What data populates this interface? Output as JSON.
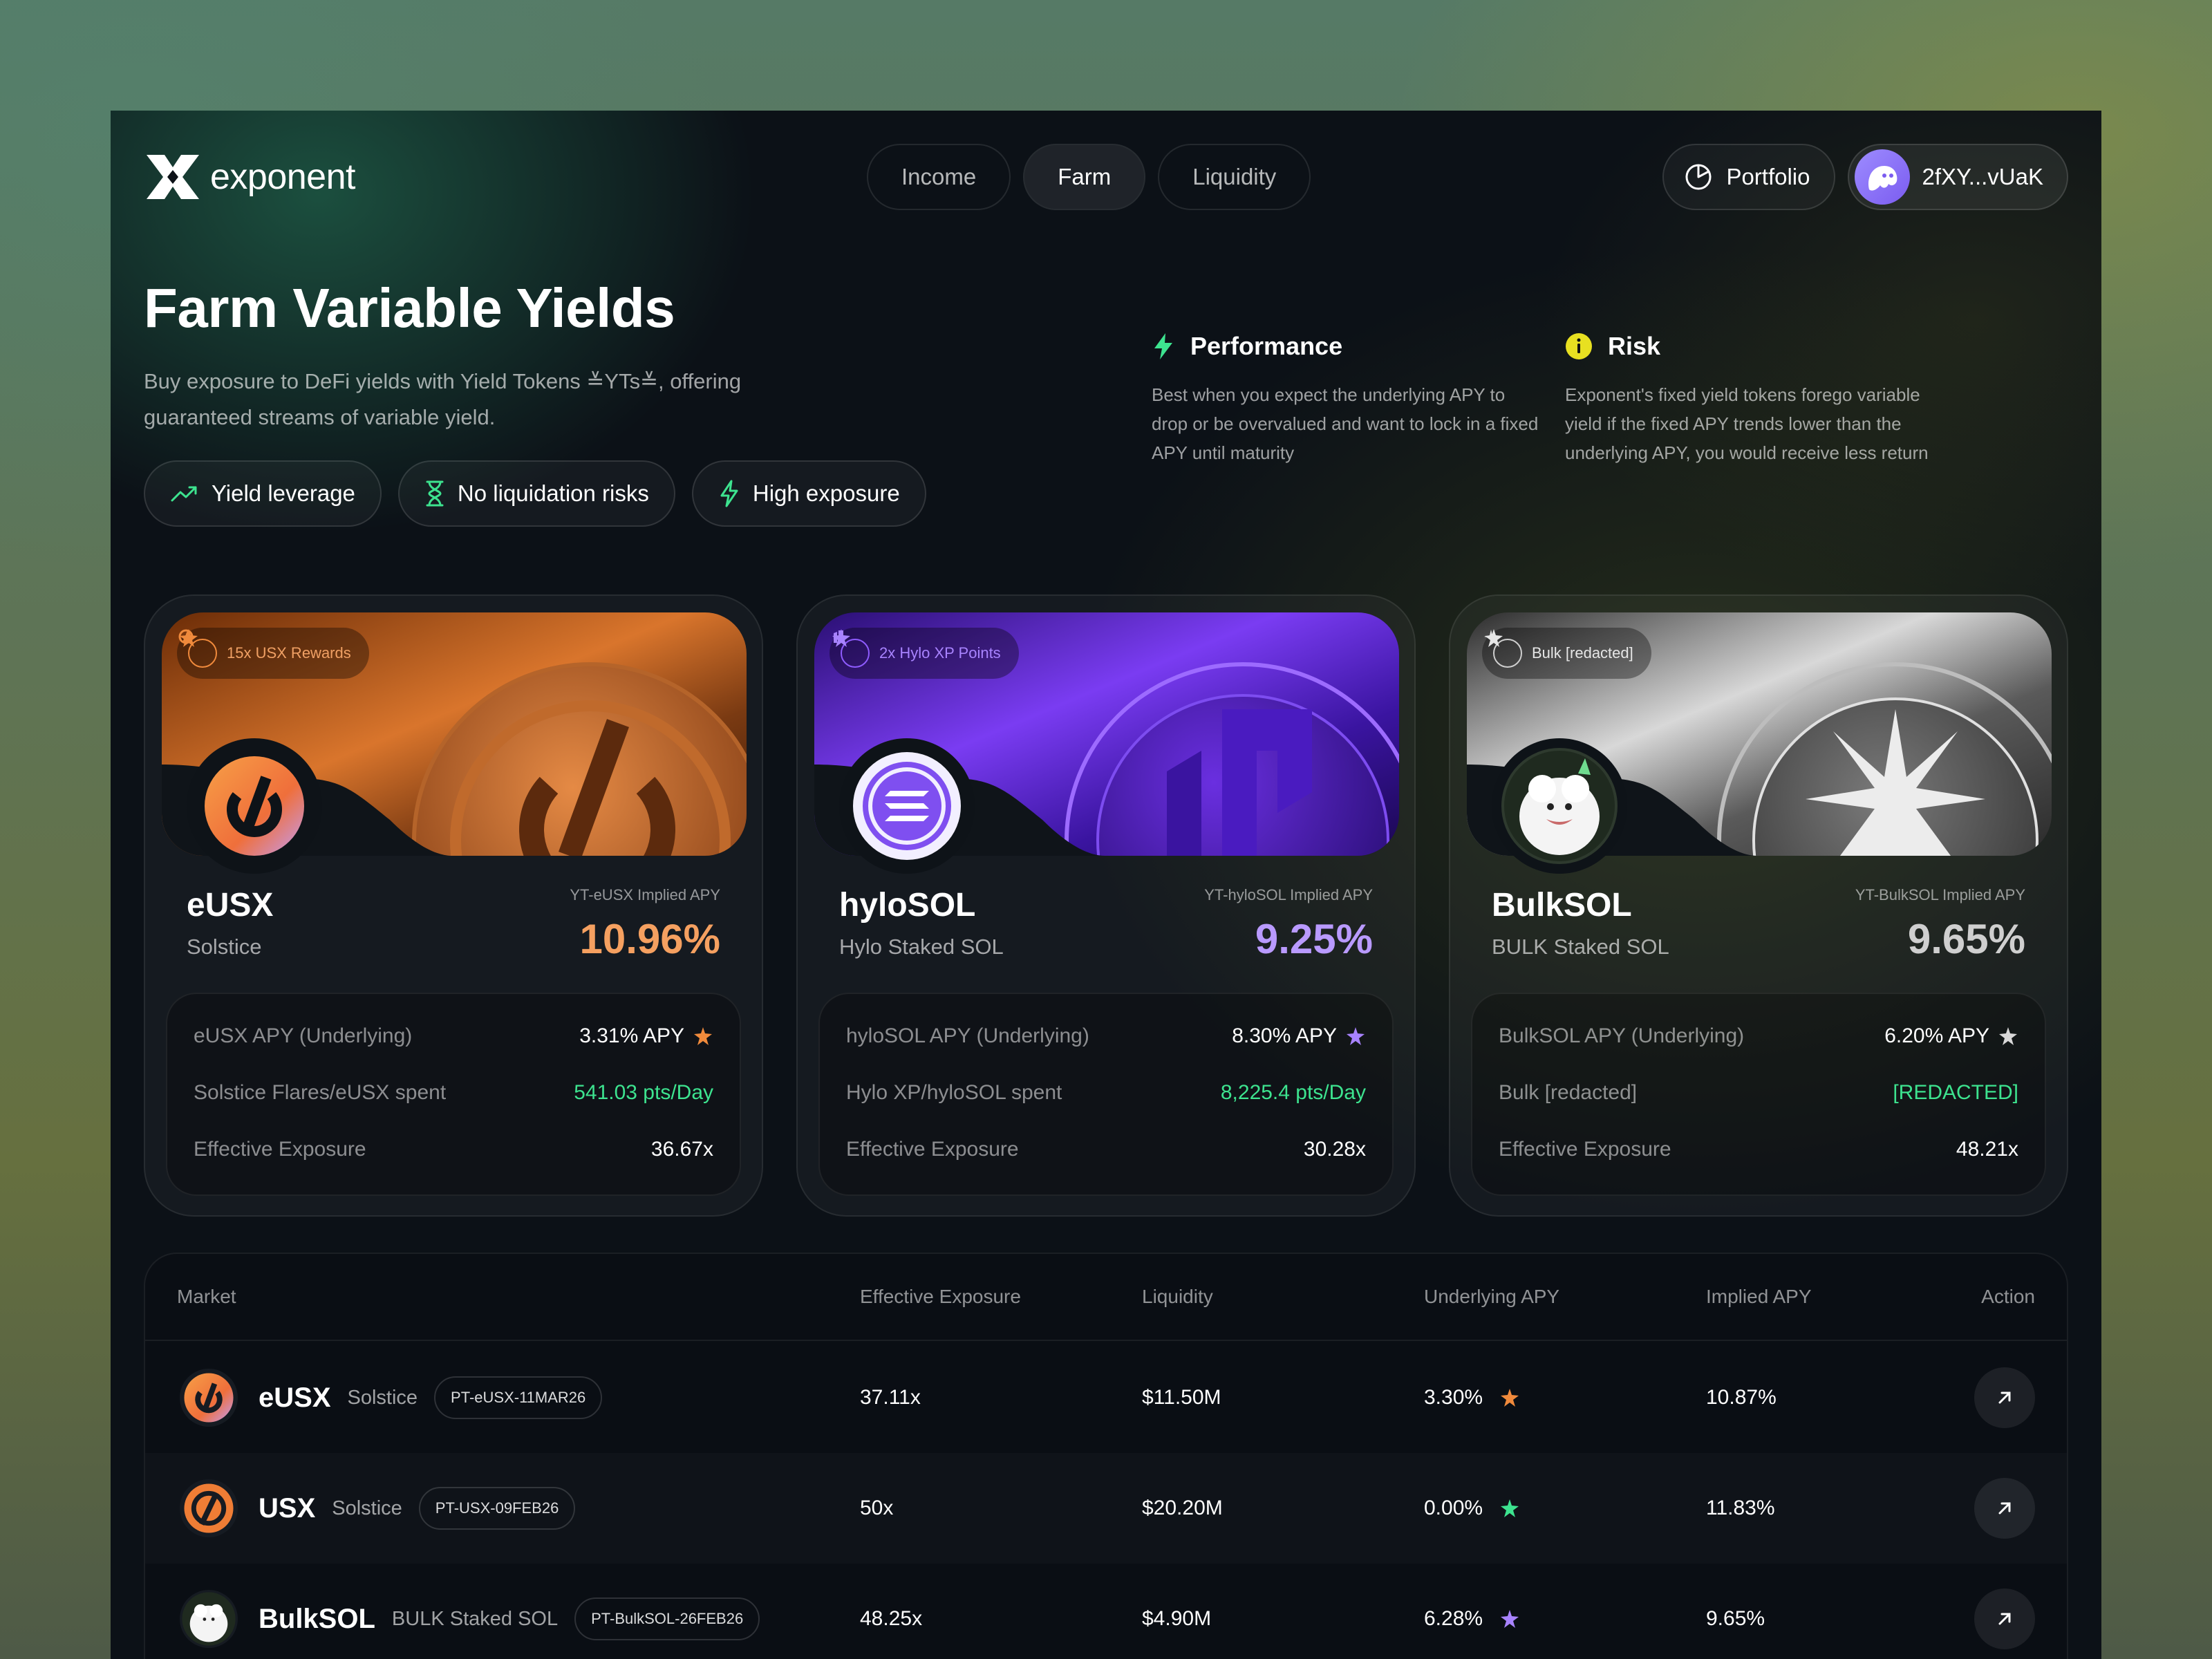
{
  "brand": {
    "name": "exponent"
  },
  "nav": {
    "tabs": [
      {
        "label": "Income"
      },
      {
        "label": "Farm"
      },
      {
        "label": "Liquidity"
      }
    ],
    "active": "Farm"
  },
  "header": {
    "portfolio_label": "Portfolio",
    "wallet_label": "2fXY...vUaK"
  },
  "hero": {
    "title": "Farm Variable Yields",
    "subtitle": "Buy exposure to DeFi yields with Yield Tokens ≚YTs≚, offering guaranteed streams of variable yield.",
    "chips": [
      {
        "label": "Yield leverage",
        "icon": "trend-up-icon"
      },
      {
        "label": "No liquidation risks",
        "icon": "hourglass-icon"
      },
      {
        "label": "High exposure",
        "icon": "lightning-icon"
      }
    ]
  },
  "info": {
    "performance": {
      "title": "Performance",
      "body": "Best when you expect the underlying APY to drop or be overvalued and want to lock in a fixed APY until maturity"
    },
    "risk": {
      "title": "Risk",
      "body": "Exponent's fixed yield tokens forego variable yield if the fixed APY trends lower than the underlying APY, you would receive less return"
    }
  },
  "cards": [
    {
      "badge": "15x USX Rewards",
      "name": "eUSX",
      "protocol": "Solstice",
      "implied_label": "YT-eUSX Implied APY",
      "implied_value": "10.96%",
      "stats": [
        {
          "label": "eUSX APY (Underlying)",
          "value": "3.31% APY"
        },
        {
          "label": "Solstice Flares/eUSX spent",
          "value": "541.03 pts/Day"
        },
        {
          "label": "Effective Exposure",
          "value": "36.67x"
        }
      ],
      "accent": "#f08a3c"
    },
    {
      "badge": "2x Hylo XP Points",
      "name": "hyloSOL",
      "protocol": "Hylo Staked SOL",
      "implied_label": "YT-hyloSOL Implied APY",
      "implied_value": "9.25%",
      "stats": [
        {
          "label": "hyloSOL APY (Underlying)",
          "value": "8.30% APY"
        },
        {
          "label": "Hylo XP/hyloSOL spent",
          "value": "8,225.4 pts/Day"
        },
        {
          "label": "Effective Exposure",
          "value": "30.28x"
        }
      ],
      "accent": "#8f5cff"
    },
    {
      "badge": "Bulk [redacted]",
      "name": "BulkSOL",
      "protocol": "BULK Staked SOL",
      "implied_label": "YT-BulkSOL Implied APY",
      "implied_value": "9.65%",
      "stats": [
        {
          "label": "BulkSOL APY (Underlying)",
          "value": "6.20% APY"
        },
        {
          "label": "Bulk [redacted]",
          "value": "[REDACTED]"
        },
        {
          "label": "Effective Exposure",
          "value": "48.21x"
        }
      ],
      "accent": "#c9c9c9"
    }
  ],
  "table": {
    "headers": {
      "market": "Market",
      "exposure": "Effective Exposure",
      "liquidity": "Liquidity",
      "underlying": "Underlying APY",
      "implied": "Implied APY",
      "action": "Action"
    },
    "rows": [
      {
        "name": "eUSX",
        "protocol": "Solstice",
        "pt": "PT-eUSX-11MAR26",
        "exposure": "37.11x",
        "liquidity": "$11.50M",
        "underlying": "3.30%",
        "implied": "10.87%"
      },
      {
        "name": "USX",
        "protocol": "Solstice",
        "pt": "PT-USX-09FEB26",
        "exposure": "50x",
        "liquidity": "$20.20M",
        "underlying": "0.00%",
        "implied": "11.83%"
      },
      {
        "name": "BulkSOL",
        "protocol": "BULK Staked SOL",
        "pt": "PT-BulkSOL-26FEB26",
        "exposure": "48.25x",
        "liquidity": "$4.90M",
        "underlying": "6.28%",
        "implied": "9.65%"
      }
    ]
  },
  "colors": {
    "green": "#3de38f",
    "orange": "#f08a3c",
    "purple": "#8f5cff",
    "silver": "#c9c9c9"
  }
}
